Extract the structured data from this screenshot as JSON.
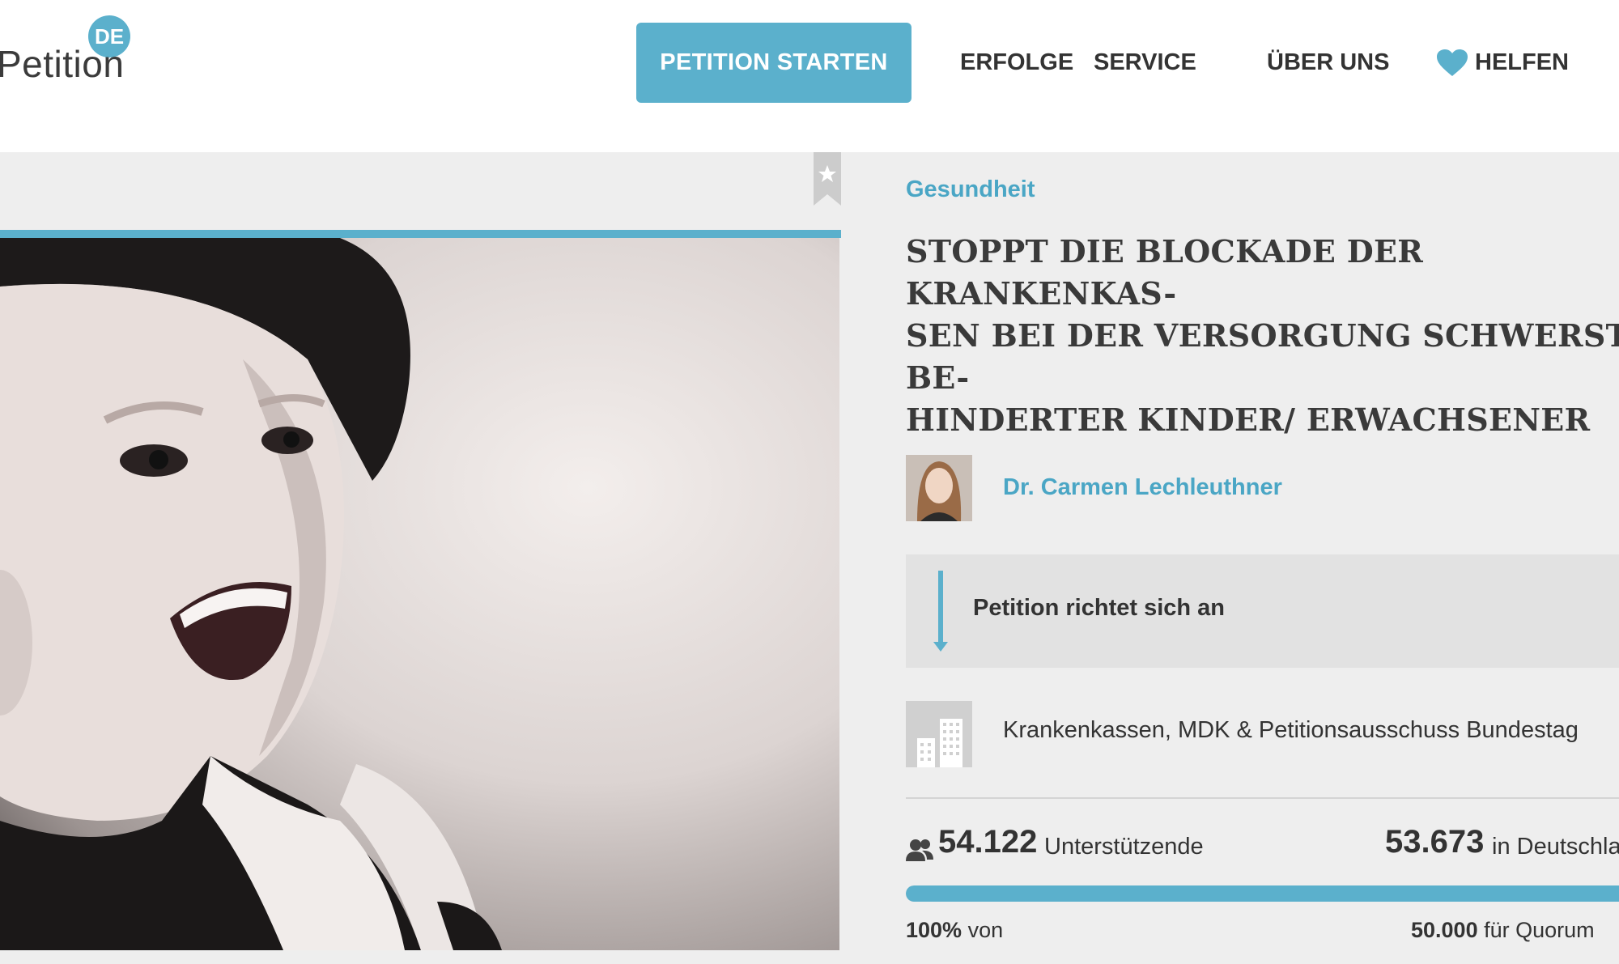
{
  "header": {
    "logo_badge": "DE",
    "logo_text": "Petition",
    "cta_label": "PETITION STARTEN",
    "nav": [
      "ERFOLGE",
      "SERVICE",
      "ÜBER UNS",
      "HELFEN"
    ]
  },
  "petition": {
    "category": "Gesundheit",
    "title": "STOPPT DIE BLOCKADE DER KRANKENKAS-SEN BEI DER VERSORGUNG SCHWERST BE-HINDERTER KINDER/ ERWACHSENER",
    "title_lines": [
      "STOPPT DIE BLOCKADE DER KRANKENKAS-",
      "SEN BEI DER VERSORGUNG SCHWERST BE-",
      "HINDERTER KINDER/ ERWACHSENER"
    ],
    "author": "Dr. Carmen Lechleuthner",
    "target_heading": "Petition richtet sich an",
    "recipient": "Krankenkassen, MDK & Petitionsausschuss Bundestag"
  },
  "stats": {
    "supporters": "54.122",
    "supporters_label": "Unterstützende",
    "germany_count": "53.673",
    "germany_label": "in Deutschland",
    "progress_percent_label": "100%",
    "progress_of": "von",
    "progress_fraction": 1.0,
    "quorum_count": "50.000",
    "quorum_label": "für Quorum"
  },
  "colors": {
    "accent": "#5bb0cc",
    "text": "#333333",
    "background": "#eeeeee"
  },
  "icons": {
    "bookmark": "star-bookmark-icon",
    "heart": "heart-icon",
    "arrow": "arrow-down-icon",
    "building": "building-icon",
    "people": "people-icon"
  }
}
